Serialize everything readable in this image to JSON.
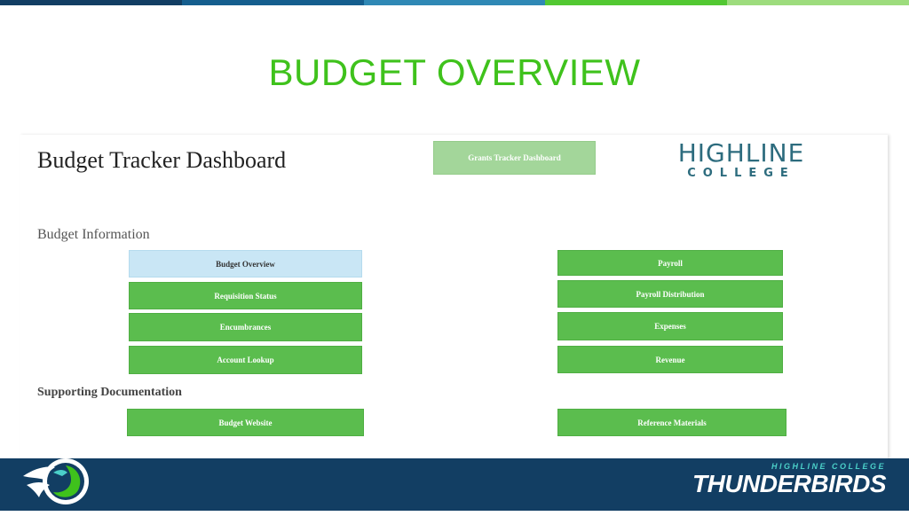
{
  "slide": {
    "title": "BUDGET OVERVIEW"
  },
  "colors": {
    "top_bar": [
      "#123e63",
      "#155e8e",
      "#2f88b5",
      "#52c832",
      "#9ddc7d"
    ],
    "button_green": "#5bbd4e",
    "button_active": "#c9e6f5",
    "title_green": "#3fc21c",
    "footer_navy": "#123e63"
  },
  "dashboard": {
    "title": "Budget Tracker Dashboard",
    "grants_button": "Grants Tracker Dashboard",
    "logo": {
      "line1": "HIGHLINE",
      "line2": "COLLEGE"
    },
    "budget_information_label": "Budget Information",
    "supporting_documentation_label": "Supporting Documentation",
    "left_buttons": [
      "Budget Overview",
      "Requisition Status",
      "Encumbrances",
      "Account Lookup"
    ],
    "right_buttons": [
      "Payroll",
      "Payroll Distribution",
      "Expenses",
      "Revenue"
    ],
    "doc_buttons": [
      "Budget Website",
      "Reference Materials"
    ],
    "active_button": "Budget Overview"
  },
  "footer": {
    "brand_small": "HIGHLINE COLLEGE",
    "brand_big": "THUNDERBIRDS",
    "mascot_icon": "thunderbird-logo-icon"
  }
}
